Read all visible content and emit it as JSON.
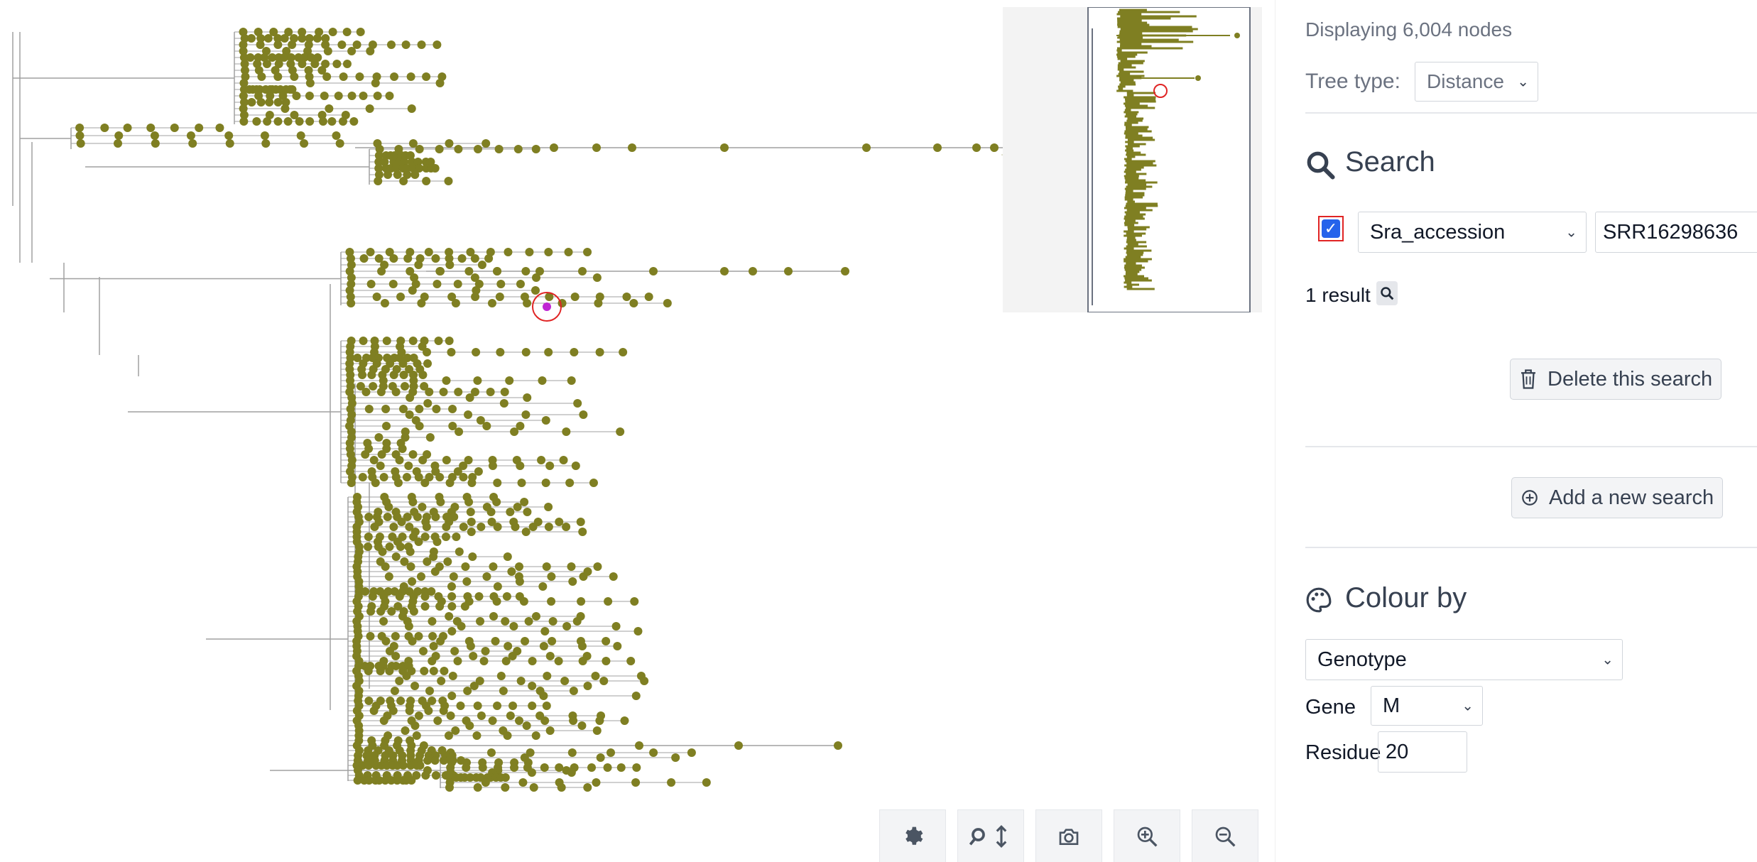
{
  "tree_view": {
    "leaf_color": "#7f7f22",
    "branch_color": "#a0a0a0",
    "highlight_color": "#c026d3",
    "highlight_ring_color": "#e02424"
  },
  "toolbar": {
    "buttons": [
      {
        "icon": "gear-icon"
      },
      {
        "icon": "search-resize-icon"
      },
      {
        "icon": "camera-icon"
      },
      {
        "icon": "zoom-in-icon"
      },
      {
        "icon": "zoom-out-icon"
      }
    ]
  },
  "sidebar": {
    "node_count": "Displaying 6,004 nodes",
    "tree_type": {
      "label": "Tree type:",
      "value": "Distance"
    },
    "search": {
      "title": "Search",
      "checked": true,
      "field": "Sra_accession",
      "value": "SRR16298636",
      "result_count": "1 result",
      "delete_label": "Delete this search",
      "add_label": "Add a new search"
    },
    "colour_by": {
      "title": "Colour by",
      "value": "Genotype",
      "gene_label": "Gene",
      "gene_value": "M",
      "residue_label": "Residue",
      "residue_value": "20"
    }
  }
}
